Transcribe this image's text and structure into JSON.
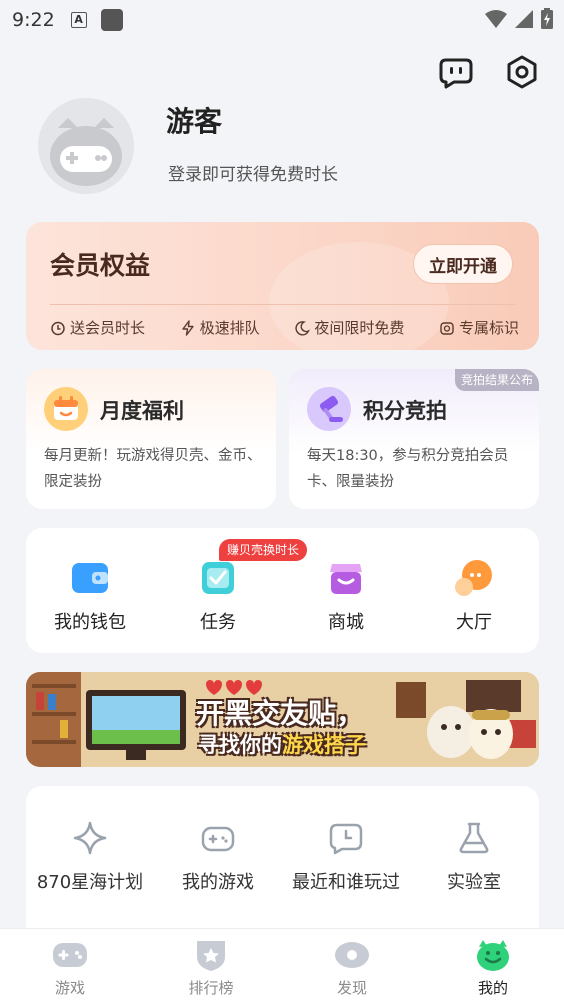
{
  "status_bar": {
    "time": "9:22",
    "a_icon_label": "A"
  },
  "header": {
    "icons": [
      "message-icon",
      "settings-icon"
    ]
  },
  "profile": {
    "name": "游客",
    "subtitle": "登录即可获得免费时长"
  },
  "vip": {
    "title": "会员权益",
    "button": "立即开通",
    "perks": [
      {
        "icon": "clock-gift-icon",
        "label": "送会员时长"
      },
      {
        "icon": "lightning-icon",
        "label": "极速排队"
      },
      {
        "icon": "moon-icon",
        "label": "夜间限时免费"
      },
      {
        "icon": "badge-icon",
        "label": "专属标识"
      }
    ]
  },
  "cards": [
    {
      "title": "月度福利",
      "desc": "每月更新！玩游戏得贝壳、金币、限定装扮",
      "icon": "calendar-icon",
      "tag": ""
    },
    {
      "title": "积分竞拍",
      "desc": "每天18:30，参与积分竞拍会员卡、限量装扮",
      "icon": "auction-hammer-icon",
      "tag": "竞拍结果公布"
    }
  ],
  "quick": {
    "badge": "赚贝壳换时长",
    "items": [
      {
        "label": "我的钱包",
        "icon": "wallet-icon"
      },
      {
        "label": "任务",
        "icon": "task-icon"
      },
      {
        "label": "商城",
        "icon": "store-icon"
      },
      {
        "label": "大厅",
        "icon": "chat-hall-icon"
      }
    ]
  },
  "banner": {
    "line1": "开黑交友贴，",
    "line2_prefix": "寻找你的",
    "line2_highlight": "游戏搭子"
  },
  "tools": [
    {
      "label": "870星海计划",
      "icon": "sparkle-icon"
    },
    {
      "label": "我的游戏",
      "icon": "gamepad-icon"
    },
    {
      "label": "最近和谁玩过",
      "icon": "recent-clock-icon"
    },
    {
      "label": "实验室",
      "icon": "flask-icon"
    }
  ],
  "tabbar": {
    "tabs": [
      {
        "label": "游戏",
        "icon": "gamepad-tab-icon"
      },
      {
        "label": "排行榜",
        "icon": "ranking-icon"
      },
      {
        "label": "发现",
        "icon": "discover-icon"
      },
      {
        "label": "我的",
        "icon": "me-monster-icon"
      }
    ],
    "active": "我的"
  },
  "colors": {
    "accent_green": "#2fd17a",
    "vip_bg": "#fbd7c9",
    "badge_red": "#ef4040"
  }
}
